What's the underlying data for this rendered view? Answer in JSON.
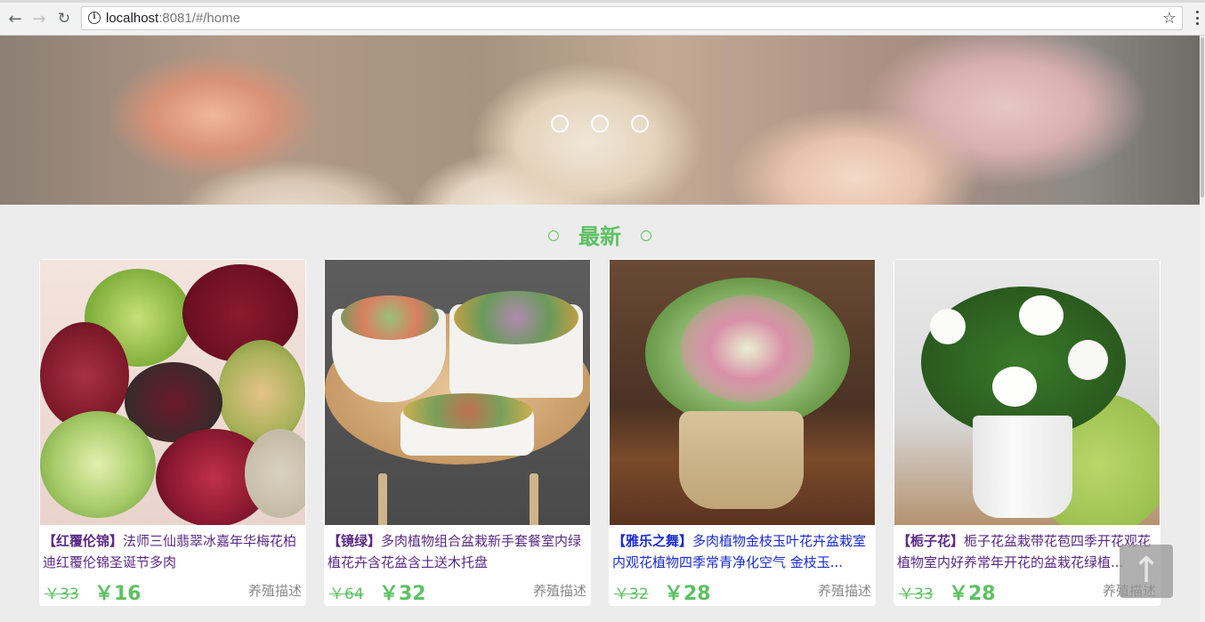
{
  "browser": {
    "url_host": "localhost",
    "url_rest": ":8081/#/home"
  },
  "section": {
    "title": "最新"
  },
  "products": [
    {
      "name": "【红覆伦锦】",
      "text": "法师三仙翡翠冰嘉年华梅花柏迪红覆伦锦圣诞节多肉",
      "old_price": "￥33",
      "price": "￥16",
      "care": "养殖描述"
    },
    {
      "name": "【镜绿】",
      "text": "多肉植物组合盆栽新手套餐室内绿植花卉含花盆含土送木托盘",
      "old_price": "￥64",
      "price": "￥32",
      "care": "养殖描述"
    },
    {
      "name": "【雅乐之舞】",
      "text": "多肉植物金枝玉叶花卉盆栽室内观花植物四季常青净化空气 金枝玉...",
      "old_price": "￥32",
      "price": "￥28",
      "care": "养殖描述"
    },
    {
      "name": "【栀子花】",
      "text": "栀子花盆栽带花苞四季开花观花植物室内好养常年开花的盆栽花绿植...",
      "old_price": "￥33",
      "price": "￥28",
      "care": "养殖描述"
    }
  ],
  "back_to_top": "↑"
}
